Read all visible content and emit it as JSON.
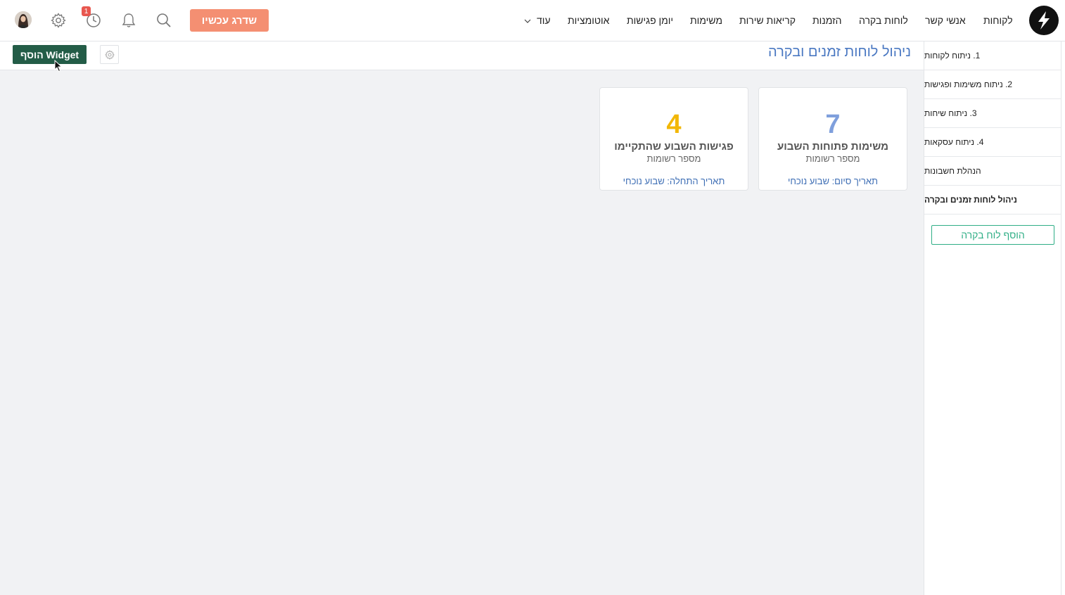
{
  "nav": {
    "items": [
      "לקוחות",
      "אנשי קשר",
      "לוחות בקרה",
      "הזמנות",
      "קריאות שירות",
      "משימות",
      "יומן פגישות",
      "אוטומציות"
    ],
    "more_label": "עוד",
    "upgrade_label": "שדרג עכשיו",
    "notification_count": "1"
  },
  "sidebar": {
    "items": [
      {
        "label": "1. ניתוח לקוחות"
      },
      {
        "label": "2. ניתוח משימות ופגישות"
      },
      {
        "label": "3. ניתוח שיחות"
      },
      {
        "label": "4. ניתוח עסקאות"
      },
      {
        "label": "הנהלת חשבונות"
      },
      {
        "label": "ניהול לוחות זמנים ובקרה"
      }
    ],
    "active_index": 5,
    "add_label": "הוסף לוח בקרה"
  },
  "header": {
    "title": "ניהול לוחות זמנים ובקרה",
    "add_widget_label": "הוסף Widget"
  },
  "widgets": [
    {
      "value": "7",
      "title": "משימות פתוחות השבוע",
      "subtitle": "מספר רשומות",
      "footer": "תאריך סיום: שבוע נוכחי",
      "color": "#7f9fdc"
    },
    {
      "value": "4",
      "title": "פגישות השבוע שהתקיימו",
      "subtitle": "מספר רשומות",
      "footer": "תאריך התחלה: שבוע נוכחי",
      "color": "#f2b705"
    }
  ],
  "colors": {
    "brand_green": "#235c47",
    "accent_teal": "#2fae86",
    "upgrade": "#f48f72",
    "title_blue": "#4a78c2"
  }
}
